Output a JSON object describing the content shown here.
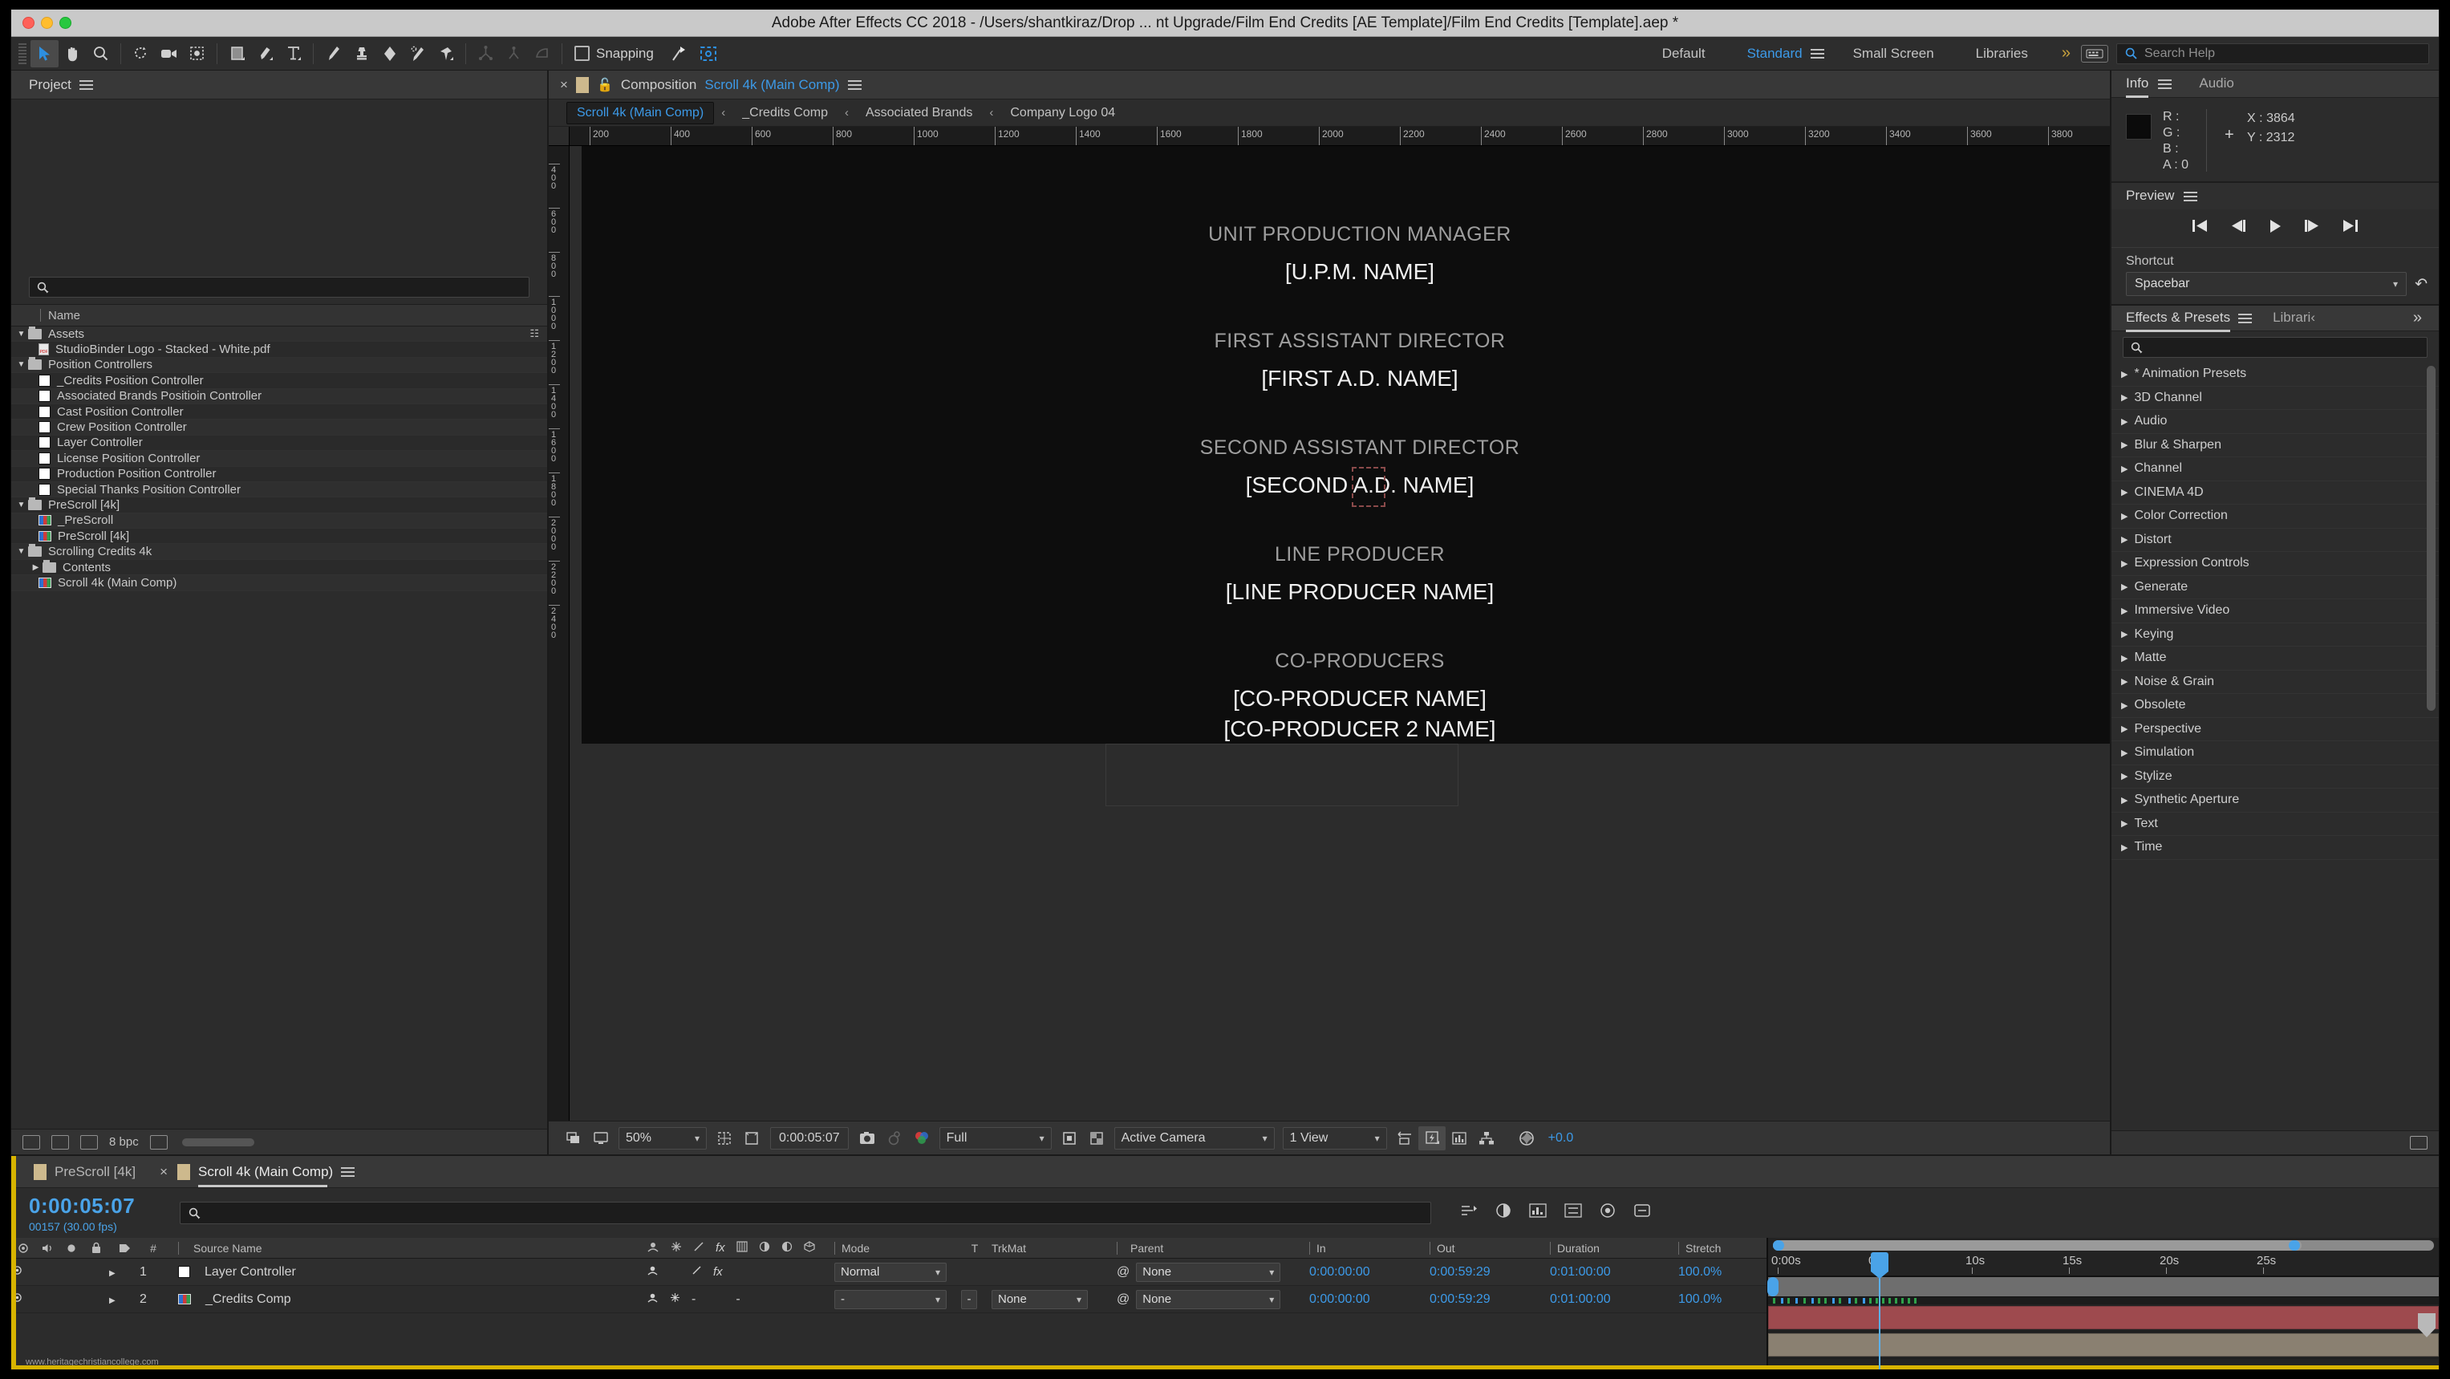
{
  "window": {
    "title": "Adobe After Effects CC 2018 - /Users/shantkiraz/Drop ... nt Upgrade/Film End Credits [AE Template]/Film End Credits [Template].aep *"
  },
  "toolbar": {
    "snapping_label": "Snapping",
    "workspaces": [
      {
        "label": "Default",
        "active": false
      },
      {
        "label": "Standard",
        "active": true
      },
      {
        "label": "Small Screen",
        "active": false
      },
      {
        "label": "Libraries",
        "active": false
      }
    ],
    "overflow": "»",
    "search_placeholder": "Search Help"
  },
  "project": {
    "tab_label": "Project",
    "column_header": "Name",
    "search_value": "",
    "bit_depth": "8 bpc",
    "items": [
      {
        "label": "Assets",
        "type": "folder",
        "depth": 0,
        "expanded": true,
        "tri": "▼"
      },
      {
        "label": "StudioBinder Logo - Stacked - White.pdf",
        "type": "pdf",
        "depth": 2
      },
      {
        "label": "Position Controllers",
        "type": "folder",
        "depth": 0,
        "expanded": true,
        "tri": "▼"
      },
      {
        "label": "_Credits Position Controller",
        "type": "solid",
        "depth": 2
      },
      {
        "label": "Associated Brands Positioin Controller",
        "type": "solid",
        "depth": 2
      },
      {
        "label": "Cast Position Controller",
        "type": "solid",
        "depth": 2
      },
      {
        "label": "Crew Position Controller",
        "type": "solid",
        "depth": 2
      },
      {
        "label": "Layer Controller",
        "type": "solid",
        "depth": 2
      },
      {
        "label": "License Position Controller",
        "type": "solid",
        "depth": 2
      },
      {
        "label": "Production Position Controller",
        "type": "solid",
        "depth": 2
      },
      {
        "label": "Special Thanks Position Controller",
        "type": "solid",
        "depth": 2
      },
      {
        "label": "PreScroll [4k]",
        "type": "folder",
        "depth": 0,
        "expanded": true,
        "tri": "▼"
      },
      {
        "label": "_PreScroll",
        "type": "comp",
        "depth": 2
      },
      {
        "label": "PreScroll [4k]",
        "type": "comp",
        "depth": 2
      },
      {
        "label": "Scrolling Credits 4k",
        "type": "folder",
        "depth": 0,
        "expanded": true,
        "tri": "▼"
      },
      {
        "label": "Contents",
        "type": "folder",
        "depth": 1,
        "expanded": false,
        "tri": "▶"
      },
      {
        "label": "Scroll 4k (Main Comp)",
        "type": "comp",
        "depth": 2
      }
    ]
  },
  "composition": {
    "panel_prefix": "Composition",
    "panel_name": "Scroll 4k (Main Comp)",
    "breadcrumbs": [
      {
        "label": "Scroll 4k (Main Comp)",
        "active": true
      },
      {
        "label": "_Credits Comp",
        "active": false
      },
      {
        "label": "Associated Brands",
        "active": false
      },
      {
        "label": "Company Logo 04",
        "active": false
      }
    ],
    "breadcrumb_separator": "‹",
    "ruler_ticks": [
      "200",
      "400",
      "600",
      "800",
      "1000",
      "1200",
      "1400",
      "1600",
      "1800",
      "2000",
      "2200",
      "2400",
      "2600",
      "2800",
      "3000",
      "3200",
      "3400",
      "3600",
      "3800"
    ],
    "ruler_ticks_v": [
      "400",
      "600",
      "800",
      "1000",
      "1200",
      "1400",
      "1600",
      "1800",
      "2000",
      "2200",
      "2400"
    ],
    "credits": [
      {
        "role": "UNIT PRODUCTION MANAGER",
        "names": [
          "[U.P.M. NAME]"
        ]
      },
      {
        "role": "FIRST ASSISTANT DIRECTOR",
        "names": [
          "[FIRST A.D. NAME]"
        ]
      },
      {
        "role": "SECOND ASSISTANT DIRECTOR",
        "names": [
          "[SECOND A.D. NAME]"
        ]
      },
      {
        "role": "LINE PRODUCER",
        "names": [
          "[LINE PRODUCER NAME]"
        ]
      },
      {
        "role": "CO-PRODUCERS",
        "names": [
          "[CO-PRODUCER NAME]",
          "[CO-PRODUCER 2 NAME]"
        ]
      }
    ],
    "viewer_bottom": {
      "magnification": "50%",
      "timecode": "0:00:05:07",
      "resolution": "Full",
      "camera": "Active Camera",
      "views": "1 View",
      "exposure": "+0.0"
    }
  },
  "info": {
    "tab_info": "Info",
    "tab_audio": "Audio",
    "r_label": "R :",
    "g_label": "G :",
    "b_label": "B :",
    "a_label": "A :",
    "r_value": "",
    "g_value": "",
    "b_value": "",
    "a_value": "0",
    "x_label": "X :",
    "x_value": "3864",
    "y_label": "Y :",
    "y_value": "2312"
  },
  "preview": {
    "tab_label": "Preview",
    "shortcut_label": "Shortcut",
    "shortcut_value": "Spacebar"
  },
  "effects": {
    "tab_label": "Effects & Presets",
    "tab_libraries": "Librari‹",
    "overflow": "»",
    "search_value": "",
    "items": [
      "* Animation Presets",
      "3D Channel",
      "Audio",
      "Blur & Sharpen",
      "Channel",
      "CINEMA 4D",
      "Color Correction",
      "Distort",
      "Expression Controls",
      "Generate",
      "Immersive Video",
      "Keying",
      "Matte",
      "Noise & Grain",
      "Obsolete",
      "Perspective",
      "Simulation",
      "Stylize",
      "Synthetic Aperture",
      "Text",
      "Time"
    ]
  },
  "timeline": {
    "tabs": [
      {
        "label": "PreScroll [4k]",
        "active": false
      },
      {
        "label": "Scroll 4k (Main Comp)",
        "active": true
      }
    ],
    "current_time": "0:00:05:07",
    "frame_info": "00157 (30.00 fps)",
    "search_value": "",
    "columns": {
      "source_name": "Source Name",
      "hash": "#",
      "mode": "Mode",
      "t": "T",
      "trkmat": "TrkMat",
      "parent": "Parent",
      "in": "In",
      "out": "Out",
      "duration": "Duration",
      "stretch": "Stretch"
    },
    "layers": [
      {
        "index": "1",
        "name": "Layer Controller",
        "icon": "solid",
        "color": "#c4443f",
        "mode": "Normal",
        "t": "",
        "trkmat": "",
        "parent": "None",
        "in": "0:00:00:00",
        "out": "0:00:59:29",
        "duration": "0:01:00:00",
        "stretch": "100.0%",
        "bar_color": "#9e4a4e"
      },
      {
        "index": "2",
        "name": "_Credits Comp",
        "icon": "comp",
        "color": "#cdb98d",
        "mode": "-",
        "t": "-",
        "trkmat": "None",
        "parent": "None",
        "in": "0:00:00:00",
        "out": "0:00:59:29",
        "duration": "0:01:00:00",
        "stretch": "100.0%",
        "bar_color": "#8a8071"
      }
    ],
    "ruler_labels": [
      "0:00s",
      "05s",
      "10s",
      "15s",
      "20s",
      "25s"
    ],
    "watermark": "www.heritagechristiancollege.com"
  },
  "colors": {
    "accent_blue": "#3c9ae8",
    "panel_bg": "#2c2c2c",
    "header_bg": "#383838",
    "yellow_edge": "#d8b400"
  }
}
